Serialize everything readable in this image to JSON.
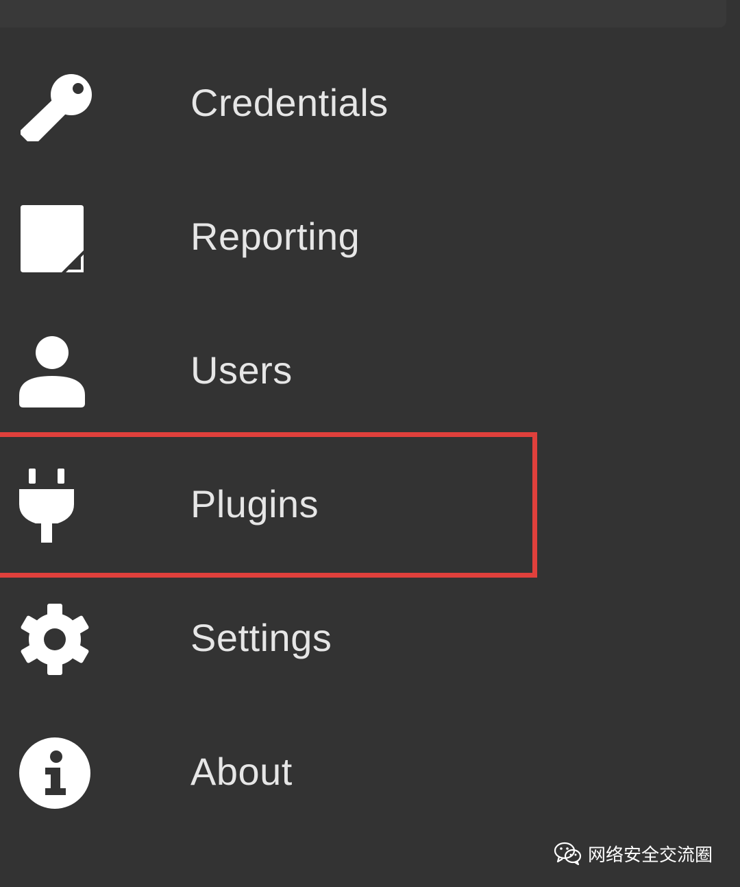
{
  "menu": {
    "items": [
      {
        "label": "Credentials",
        "icon": "key-icon"
      },
      {
        "label": "Reporting",
        "icon": "note-icon"
      },
      {
        "label": "Users",
        "icon": "user-icon"
      },
      {
        "label": "Plugins",
        "icon": "plug-icon",
        "highlighted": true
      },
      {
        "label": "Settings",
        "icon": "gear-icon"
      },
      {
        "label": "About",
        "icon": "info-icon"
      }
    ]
  },
  "watermark": {
    "text": "网络安全交流圈",
    "icon": "wechat-icon"
  },
  "colors": {
    "background": "#333333",
    "text": "#e6e6e6",
    "icon": "#ffffff",
    "highlight_border": "#e0403c"
  }
}
